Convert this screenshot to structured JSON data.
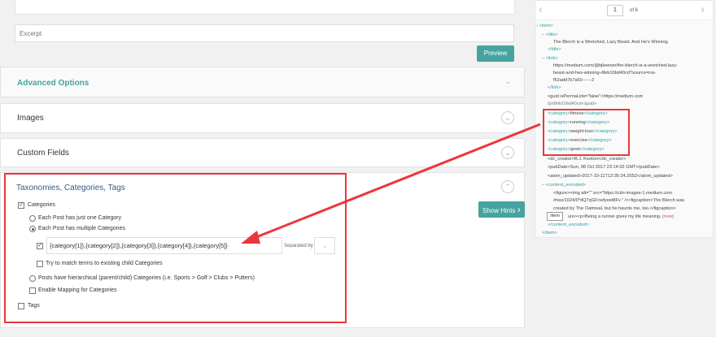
{
  "excerpt": {
    "placeholder": "Excerpt"
  },
  "preview_label": "Preview",
  "sections": {
    "advanced": "Advanced Options",
    "images": "Images",
    "custom_fields": "Custom Fields",
    "taxonomies": "Taxonomies, Categories, Tags"
  },
  "show_hints": "Show Hints",
  "taxonomy": {
    "categories": "Categories",
    "one_category": "Each Post has just one Category",
    "multiple_categories": "Each Post has multiple Categories",
    "category_value": "{category[1]},{category[2]},{category[3]},{category[4]},{category[5]}",
    "separated_by": "Separated by",
    "separator": ",",
    "match_child": "Try to match terms to existing child Categories",
    "hierarchical": "Posts have hierarchical (parent/child) Categories (i.e. Sports > Golf > Clubs > Putters)",
    "enable_mapping": "Enable Mapping for Categories",
    "tags": "Tags"
  },
  "pager": {
    "page": "1",
    "of": "of 6"
  },
  "xml": {
    "item_open": "<item>",
    "title_open": "<title>",
    "title_text": "The Blerch is a Wretched, Lazy Beast. And He's Winning.",
    "title_close": "</title>",
    "link_open": "<link>",
    "link_1": "https://medium.com/@bjkeeton/the-blerch-is-a-wretched-lazy-",
    "link_2": "beast-and-hes-winning-dfeb10bd40cd?source=rss-",
    "link_3": "f52add7b7a50------2",
    "link_close": "</link>",
    "guid_1": "<guid isPermaLink=\"false\">https://medium.com",
    "guid_2": "/p/dfeb10bd40cd</guid>",
    "categories": [
      "fitness",
      "running",
      "weight-loss",
      "exercise",
      "geek"
    ],
    "dc_creator": "<dc_creator>B.J. Keeton</dc_creator>",
    "pubdate": "<pubDate>Sun, 08 Oct 2017 23:14:02 GMT</pubDate>",
    "atom": "<atom_updated>2017-10-11T13:35:24.255Z</atom_updated>",
    "content_open": "<content_encoded>",
    "content_1": "<figure><img alt=\"\" src=\"https://cdn-images-1.medium.com",
    "content_2": "/max/1024/0*dQ7qGFcwfyeet8Fv.\" /><figcaption>The Blerch was",
    "content_3": "created by The Oatmeal, but he haunts me, too.</figcaption>",
    "content_4": "ure><p>Being a runner gives my life meaning.",
    "more": "[more]",
    "tooltip": "/item",
    "content_close": "</content_encoded>",
    "item_close": "</item>"
  },
  "colors": {
    "accent": "#46a3a0",
    "highlight": "#e8383d"
  }
}
